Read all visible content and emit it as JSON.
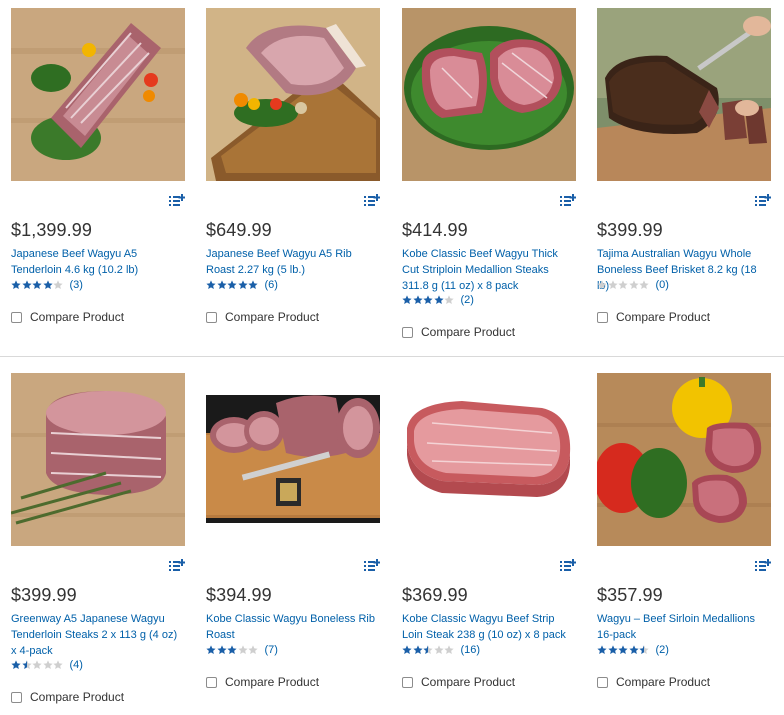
{
  "colors": {
    "link": "#0060a9",
    "star_filled": "#1a5fa8",
    "star_empty": "#cfcfcf"
  },
  "compare_label": "Compare Product",
  "products": [
    {
      "price": "$1,399.99",
      "title": "Japanese Beef Wagyu A5 Tenderloin 4.6 kg (10.2 lb)",
      "rating": 4,
      "reviews": "(3)",
      "image": "tenderloin-on-board"
    },
    {
      "price": "$649.99",
      "title": "Japanese Beef Wagyu A5 Rib Roast 2.27 kg (5 lb.)",
      "rating": 5,
      "reviews": "(6)",
      "image": "rib-roast-on-board"
    },
    {
      "price": "$414.99",
      "title": "Kobe Classic Beef Wagyu Thick Cut Striploin Medallion Steaks 311.8 g (11 oz) x 8 pack",
      "rating": 4,
      "reviews": "(2)",
      "image": "medallions-on-kale"
    },
    {
      "price": "$399.99",
      "title": "Tajima Australian Wagyu Whole Boneless Beef Brisket 8.2 kg (18 lb)",
      "rating": 0,
      "reviews": "(0)",
      "image": "brisket-being-sliced"
    },
    {
      "price": "$399.99",
      "title": "Greenway A5 Japanese Wagyu Tenderloin Steaks 2 x 113 g (4 oz) x 4-pack",
      "rating": 1.5,
      "reviews": "(4)",
      "image": "tenderloin-steak-rosemary"
    },
    {
      "price": "$394.99",
      "title": "Kobe Classic Wagyu Boneless Rib Roast",
      "rating": 3,
      "reviews": "(7)",
      "image": "rib-roast-sliced-board"
    },
    {
      "price": "$369.99",
      "title": "Kobe Classic Wagyu Beef Strip Loin Steak 238 g (10 oz) x 8 pack",
      "rating": 2.5,
      "reviews": "(16)",
      "image": "strip-loin-steak"
    },
    {
      "price": "$357.99",
      "title": "Wagyu – Beef Sirloin Medallions 16-pack",
      "rating": 4.5,
      "reviews": "(2)",
      "image": "sirloin-peppers"
    }
  ]
}
